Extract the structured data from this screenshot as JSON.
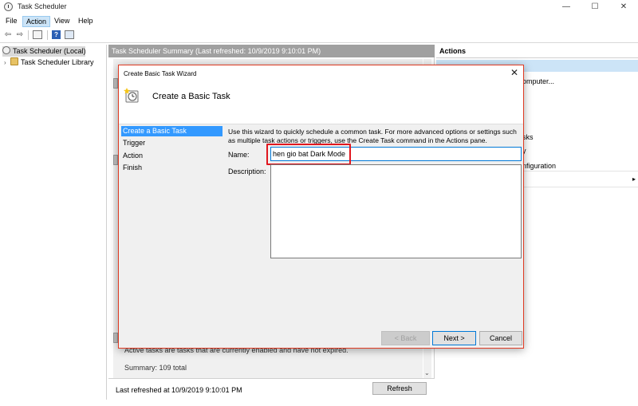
{
  "window": {
    "title": "Task Scheduler",
    "minimize": "—",
    "maximize": "☐",
    "close": "✕"
  },
  "menu": [
    "File",
    "Action",
    "View",
    "Help"
  ],
  "tree": {
    "root": "Task Scheduler (Local)",
    "library": "Task Scheduler Library"
  },
  "summary": {
    "header": "Task Scheduler Summary (Last refreshed: 10/9/2019 9:10:01 PM)",
    "active_text": "Active tasks are tasks that are currently enabled and have not expired.",
    "summary_total": "Summary: 109 total",
    "last_refreshed": "Last refreshed at 10/9/2019 9:10:01 PM",
    "refresh_button": "Refresh"
  },
  "actions": {
    "header": "Actions",
    "items": [
      "omputer...",
      "sks",
      "y",
      "nfiguration"
    ]
  },
  "dialog": {
    "title": "Create Basic Task Wizard",
    "heading": "Create a Basic Task",
    "steps": [
      "Create a Basic Task",
      "Trigger",
      "Action",
      "Finish"
    ],
    "intro": "Use this wizard to quickly schedule a common task.  For more advanced options or settings such as multiple task actions or triggers, use the Create Task command in the Actions pane.",
    "name_label": "Name:",
    "name_value": "hen gio bat Dark Mode",
    "description_label": "Description:",
    "description_value": "",
    "back_button": "< Back",
    "next_button": "Next >",
    "cancel_button": "Cancel"
  },
  "colors": {
    "accent": "#3399ff",
    "highlight_box": "#e0161e",
    "dialog_border": "#e03b24",
    "header_gray": "#a0a0a0"
  }
}
